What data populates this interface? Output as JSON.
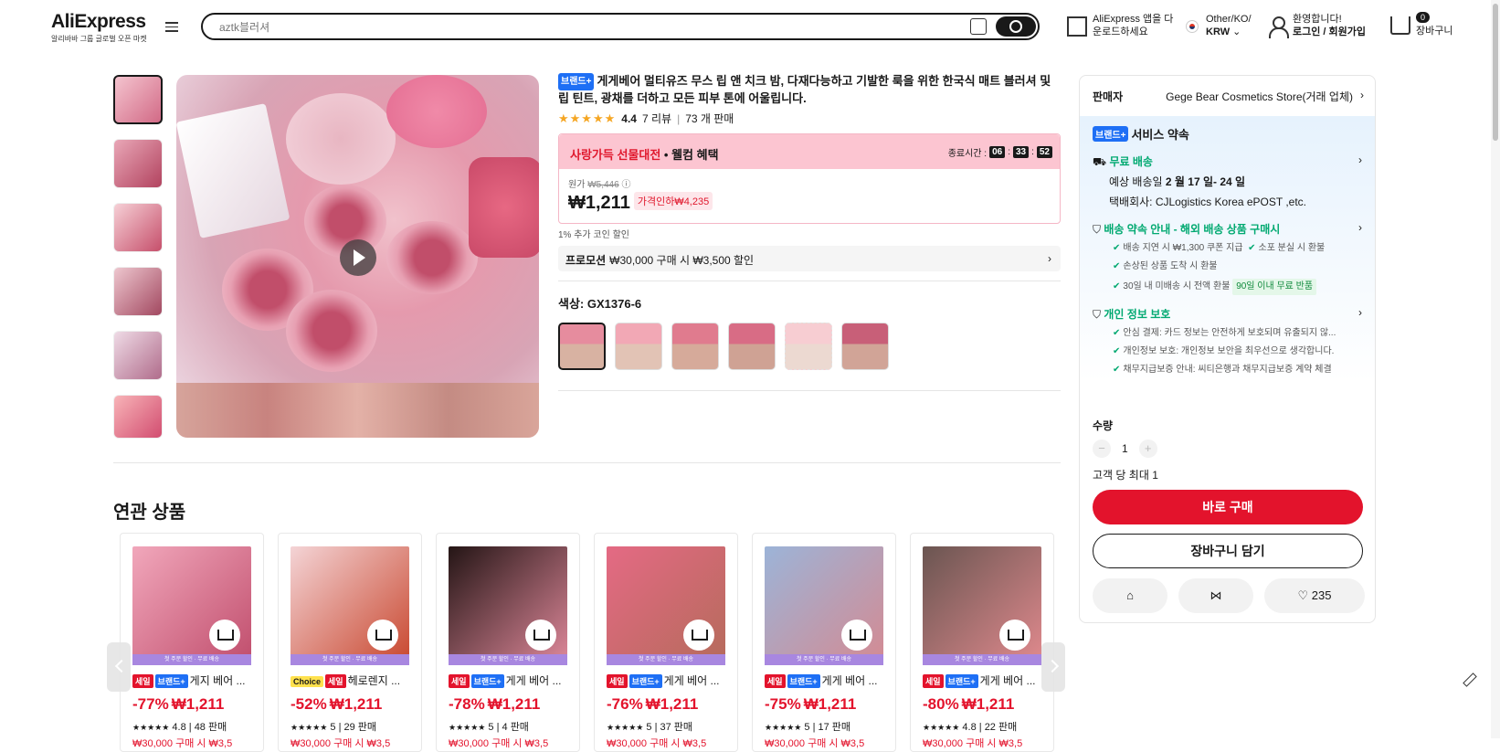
{
  "header": {
    "logo": "AliExpress",
    "logo_sub": "알리바바 그룹 글로벌 오픈 마켓",
    "search_placeholder": "aztk블러셔",
    "app_line1": "AliExpress 앱을 다",
    "app_line2": "운로드하세요",
    "region_line1": "Other/KO/",
    "region_line2": "KRW",
    "user_line1": "환영합니다!",
    "user_line2": "로그인 / 회원가입",
    "cart_count": "0",
    "cart_label": "장바구니"
  },
  "product": {
    "brand_badge": "브랜드+",
    "title": "게게베어 멀티유즈 무스 립 앤 치크 밤, 다재다능하고 기발한 룩을 위한 한국식 매트 블러셔 및 립 틴트, 광채를 더하고 모든 피부 톤에 어울립니다.",
    "rating": "4.4",
    "reviews": "7 리뷰",
    "sold": "73 개 판매",
    "deal_title_red": "사랑가득 선물대전",
    "deal_title": " • 웰컴 혜택",
    "countdown_label": "종료시간 :",
    "countdown": [
      "06",
      "33",
      "52"
    ],
    "orig_label": "원가",
    "orig_price": "₩5,446",
    "price": "₩1,211",
    "discount": "가격인하₩4,235",
    "coin": "1% 추가 코인 할인",
    "promo_label": "프로모션",
    "promo_text": "₩30,000 구매 시 ₩3,500 할인",
    "color_label": "색상: GX1376-6"
  },
  "side": {
    "seller_label": "판매자",
    "seller_name": "Gege Bear Cosmetics Store(거래 업체)",
    "svc_badge": "브랜드+",
    "svc_title": "서비스 약속",
    "free_ship": "무료 배송",
    "eta_prefix": "예상 배송일",
    "eta": "2 월 17 일- 24 일",
    "carrier": "택배회사:  CJLogistics  Korea ePOST ,etc.",
    "ship_promise": "배송 약속 안내 - 해외 배송 상품 구매시",
    "checks1": [
      "배송 지연 시 ₩1,300 쿠폰 지급",
      "소포 분실 시 환불",
      "손상된 상품 도착 시 환불",
      "30일 내 미배송 시 전액 환불"
    ],
    "return_badge": "90일 이내 무료 반품",
    "privacy": "개인 정보 보호",
    "checks2": [
      "안심 결제: 카드 정보는 안전하게 보호되며 유출되지 않...",
      "개인정보 보호: 개인정보 보안을 최우선으로 생각합니다.",
      "채무지급보증 안내: 씨티은행과 채무지급보증 계약 체결"
    ],
    "qty_label": "수량",
    "qty": "1",
    "max_qty": "고객 당 최대 1",
    "buy": "바로 구매",
    "add_cart": "장바구니 담기",
    "wish_count": "235"
  },
  "related": {
    "title": "연관 상품",
    "strip": "첫 주문 할인 · 무료 배송",
    "items": [
      {
        "tag1": "세일",
        "tag2": "브랜드+",
        "name": "게지 베어 ...",
        "pct": "-77%",
        "price": "₩1,211",
        "rating": "4.8",
        "sold": "48 판매",
        "promo": "₩30,000 구매 시 ₩3,5"
      },
      {
        "tag1": "Choice",
        "tag2": "세일",
        "name": "헤로렌지 ...",
        "pct": "-52%",
        "price": "₩1,211",
        "rating": "5",
        "sold": "29 판매",
        "promo": "₩30,000 구매 시 ₩3,5"
      },
      {
        "tag1": "세일",
        "tag2": "브랜드+",
        "name": "게게 베어 ...",
        "pct": "-78%",
        "price": "₩1,211",
        "rating": "5",
        "sold": "4 판매",
        "promo": "₩30,000 구매 시 ₩3,5"
      },
      {
        "tag1": "세일",
        "tag2": "브랜드+",
        "name": "게게 베어 ...",
        "pct": "-76%",
        "price": "₩1,211",
        "rating": "5",
        "sold": "37 판매",
        "promo": "₩30,000 구매 시 ₩3,5"
      },
      {
        "tag1": "세일",
        "tag2": "브랜드+",
        "name": "게게 베어 ...",
        "pct": "-75%",
        "price": "₩1,211",
        "rating": "5",
        "sold": "17 판매",
        "promo": "₩30,000 구매 시 ₩3,5"
      },
      {
        "tag1": "세일",
        "tag2": "브랜드+",
        "name": "게게 베어 ...",
        "pct": "-80%",
        "price": "₩1,211",
        "rating": "4.8",
        "sold": "22 판매",
        "promo": "₩30,000 구매 시 ₩3,5"
      }
    ]
  },
  "icons": [
    "menu-icon",
    "camera-search-icon",
    "search-icon",
    "qr-icon",
    "flag-icon",
    "user-icon",
    "cart-icon",
    "play-icon",
    "truck-icon",
    "shield-icon",
    "store-icon",
    "share-icon",
    "heart-icon",
    "edit-icon"
  ]
}
